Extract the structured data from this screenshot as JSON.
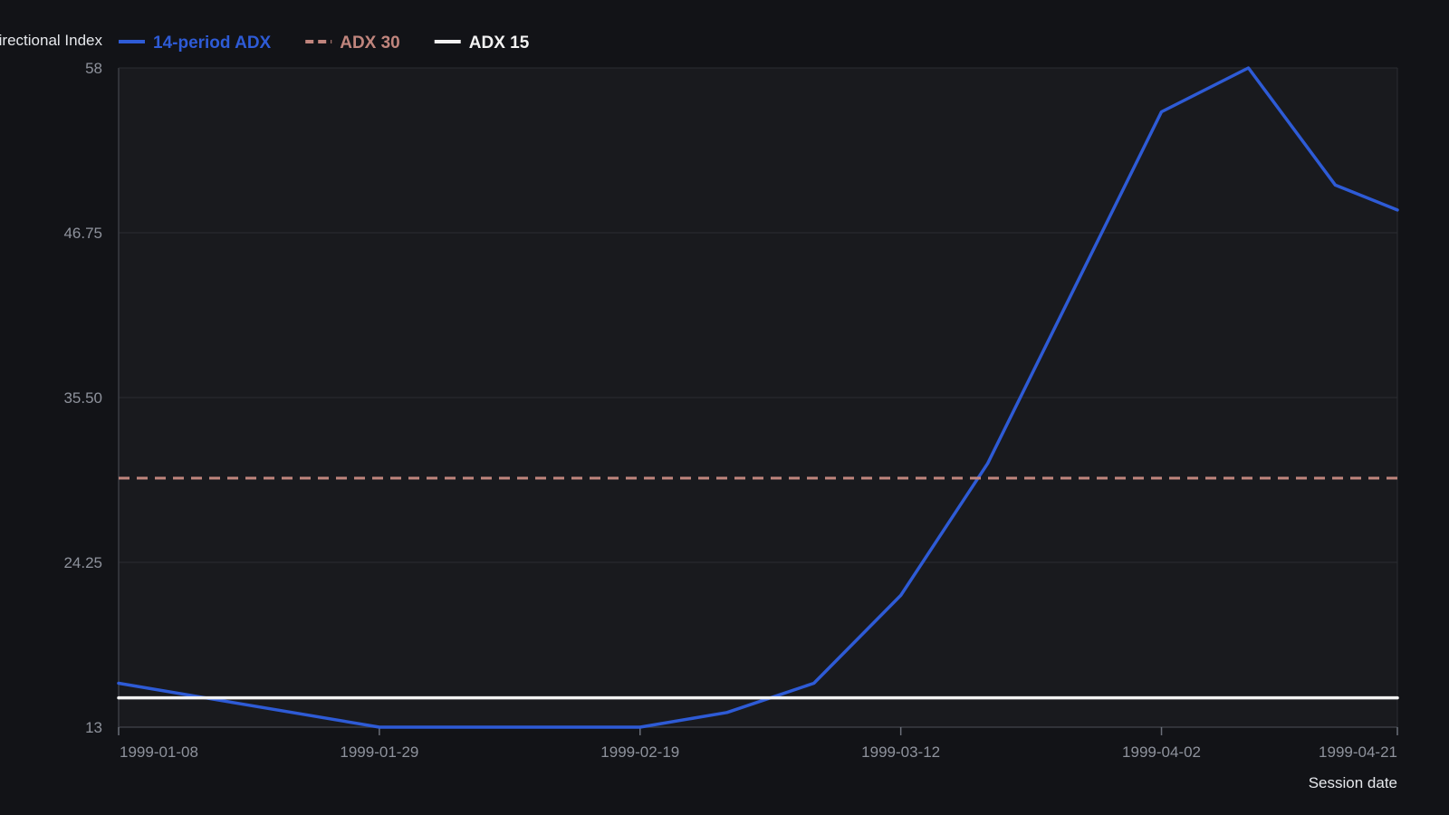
{
  "chart_data": {
    "type": "line",
    "title": "",
    "ylabel": "Average Directional Index",
    "xlabel": "Session date",
    "ylim": [
      13,
      58
    ],
    "xlim": [
      "1999-01-08",
      "1999-04-21"
    ],
    "yticks": [
      "13",
      "24.25",
      "35.50",
      "46.75",
      "58"
    ],
    "xticks": [
      "1999-01-08",
      "1999-01-29",
      "1999-02-19",
      "1999-03-12",
      "1999-04-02",
      "1999-04-21"
    ],
    "grid": true,
    "legend_position": "top-left",
    "series": [
      {
        "name": "14-period ADX",
        "color": "#2e5bd6",
        "style": "solid",
        "points": [
          {
            "x": "1999-01-08",
            "y": 16.0
          },
          {
            "x": "1999-01-29",
            "y": 13.0
          },
          {
            "x": "1999-02-19",
            "y": 13.0
          },
          {
            "x": "1999-02-26",
            "y": 14.0
          },
          {
            "x": "1999-03-05",
            "y": 16.0
          },
          {
            "x": "1999-03-12",
            "y": 22.0
          },
          {
            "x": "1999-03-19",
            "y": 31.0
          },
          {
            "x": "1999-03-26",
            "y": 43.0
          },
          {
            "x": "1999-04-02",
            "y": 55.0
          },
          {
            "x": "1999-04-09",
            "y": 58.0
          },
          {
            "x": "1999-04-16",
            "y": 50.0
          },
          {
            "x": "1999-04-21",
            "y": 48.3
          }
        ]
      },
      {
        "name": "ADX 30",
        "color": "#c0857d",
        "style": "dashed",
        "points": [
          {
            "x": "1999-01-08",
            "y": 30
          },
          {
            "x": "1999-04-21",
            "y": 30
          }
        ]
      },
      {
        "name": "ADX 15",
        "color": "#f2f2f2",
        "style": "solid",
        "points": [
          {
            "x": "1999-01-08",
            "y": 15
          },
          {
            "x": "1999-04-21",
            "y": 15
          }
        ]
      }
    ]
  }
}
